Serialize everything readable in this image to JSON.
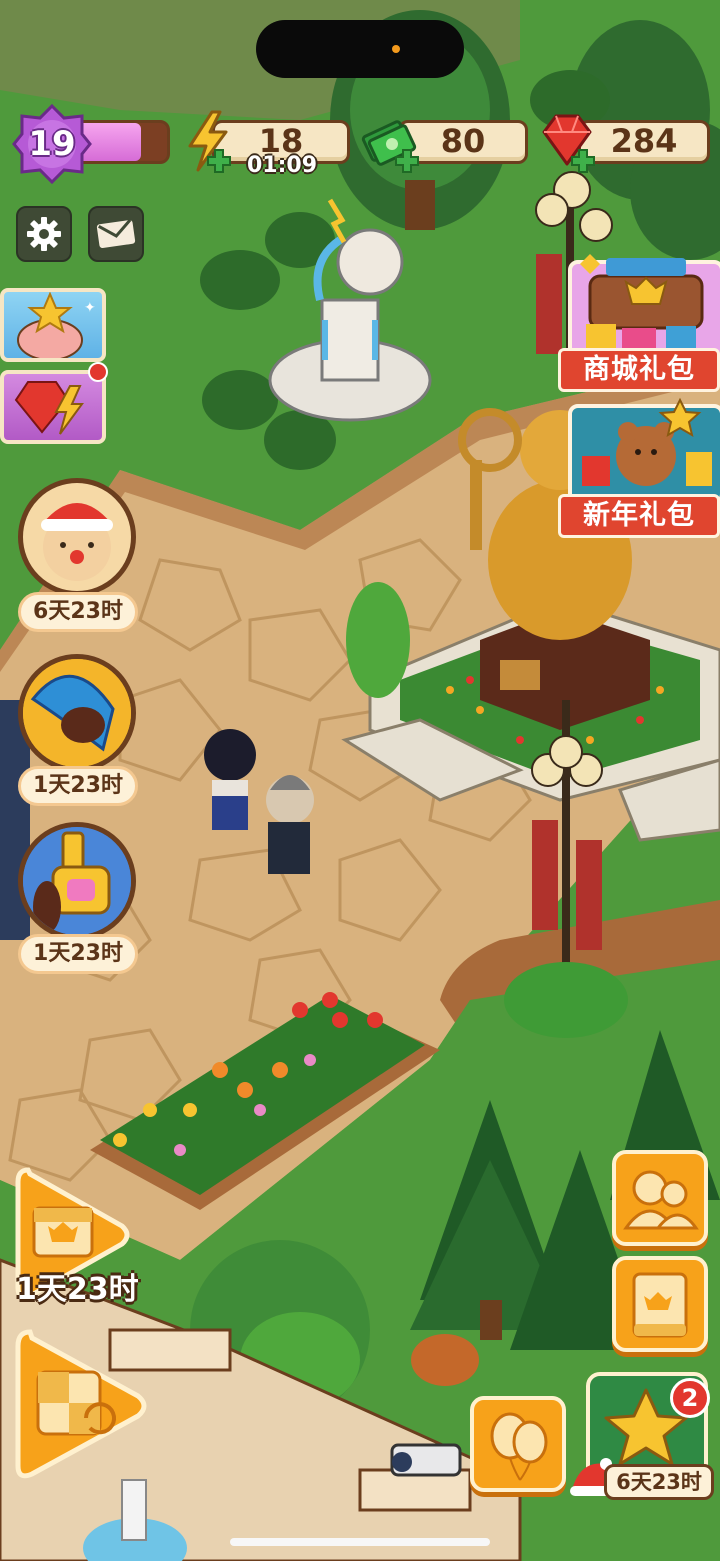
{
  "hud": {
    "level": "19",
    "level_progress": 0.72,
    "energy": "18",
    "energy_timer": "01:09",
    "cash": "80",
    "gems": "284"
  },
  "top_buttons": {
    "settings_icon": "gear-icon",
    "mail_icon": "envelope-icon"
  },
  "left_events": [
    {
      "icon": "pig-star-event-icon"
    },
    {
      "icon": "gem-lightning-event-icon"
    }
  ],
  "round_events": [
    {
      "icon": "reindeer-event-icon",
      "timer": "6天23时"
    },
    {
      "icon": "puzzle-event-icon",
      "timer": "1天23时"
    },
    {
      "icon": "key-event-icon",
      "timer": "1天23时"
    }
  ],
  "packs": {
    "shop_pack": "商城礼包",
    "new_year_pack": "新年礼包"
  },
  "left_arrows": {
    "calendar_timer": "1天23时"
  },
  "right_buttons": {
    "friends_icon": "friends-icon",
    "book_icon": "book-icon",
    "balloon_icon": "balloon-icon",
    "star_badge": "2",
    "star_timer": "6天23时"
  },
  "colors": {
    "grass": "#4f9a3c",
    "path_stone": "#d9b27e",
    "hud_bar": "#f6e6c4",
    "hud_border": "#6b3e1e",
    "pack_label": "#e0452f",
    "orange_button": "#f7a21a"
  }
}
